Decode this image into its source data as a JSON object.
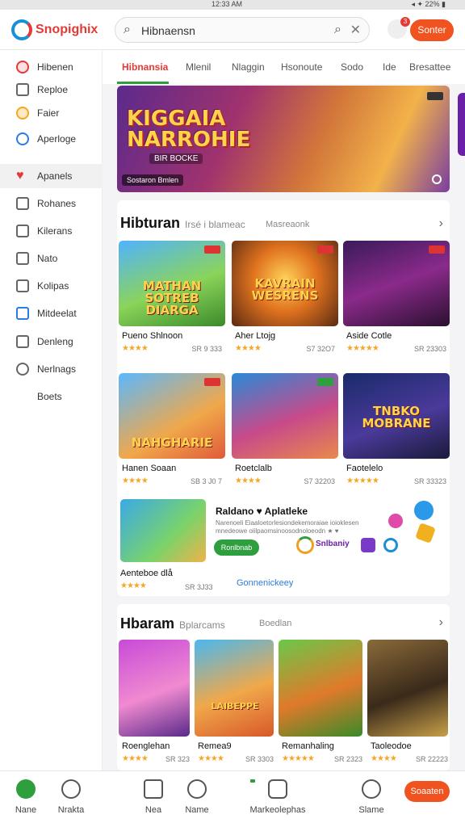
{
  "status_bar": {
    "time": "12:33 AM",
    "right": "◂ ✦ 22% ▮"
  },
  "header": {
    "logo_text": "Snopighix",
    "search_value": "Hibnaensn",
    "notif_count": "3",
    "button_label": "Sonter"
  },
  "sidebar": {
    "items": [
      {
        "label": "Hibenen",
        "icon": "dice-icon"
      },
      {
        "label": "Reploe",
        "icon": "image-icon"
      },
      {
        "label": "Faier",
        "icon": "star-icon"
      },
      {
        "label": "Aperloge",
        "icon": "globe-icon"
      },
      {
        "label": "Apanels",
        "icon": "heart-icon"
      },
      {
        "label": "Rohanes",
        "icon": "grid-icon"
      },
      {
        "label": "Kilerans",
        "icon": "grid-icon"
      },
      {
        "label": "Nato",
        "icon": "edit-icon"
      },
      {
        "label": "Kolipas",
        "icon": "box-icon"
      },
      {
        "label": "Mitdeelat",
        "icon": "list-icon"
      },
      {
        "label": "Denleng",
        "icon": "check-icon"
      },
      {
        "label": "Nerlnags",
        "icon": "settings-icon"
      },
      {
        "label": "Boets",
        "icon": ""
      }
    ]
  },
  "tabs": [
    "Hibnansia",
    "Mlenil",
    "Nlaggin",
    "Hsonoute",
    "Sodo",
    "Ide",
    "Bresattee"
  ],
  "banner": {
    "title": "KIGGAIA NARROHIE",
    "sub": "BIR BOCKE",
    "button": "Sostaron Bmlen"
  },
  "section1": {
    "title": "Hibturan",
    "sub": "Irsé i blameac",
    "sub2": "Masreaonk",
    "cards": [
      {
        "art": "MATHAN SOTREB DIARGA",
        "name": "Pueno Shlnoon",
        "stars": "★★★★",
        "price": "SR 9 333"
      },
      {
        "art": "KAVRAIN WESRENS",
        "name": "Aher Ltojg",
        "stars": "★★★★",
        "price": "S7 32O7"
      },
      {
        "art": "",
        "name": "Aside Cotle",
        "stars": "★★★★★",
        "price": "SR 23303"
      },
      {
        "art": "NAHGHARIE",
        "name": "Hanen Soaan",
        "stars": "★★★★",
        "price": "SB 3 J0 7"
      },
      {
        "art": "",
        "name": "Roetclalb",
        "stars": "★★★★",
        "price": "S7 32203"
      },
      {
        "art": "TNBKO MOBRANE",
        "name": "Faotelelo",
        "stars": "★★★★★",
        "price": "SR 33323"
      }
    ],
    "promo": {
      "title": "Raldano ♥ Aplatleke",
      "desc": "Narenoeli Eiaaloetorlesiondekemoraiae ioioklesen mnedeowe oiilpaomsinoosodnoloeodn ★ ♥",
      "button": "Ronlbnab",
      "brand": "Snlbaniy",
      "name": "Aenteboe dlå",
      "stars": "★★★★",
      "price": "SR 3J33",
      "link": "Gonnenickeey"
    }
  },
  "section2": {
    "title": "Hbaram",
    "sub": "Bplarcams",
    "sub2": "Boedlan",
    "cards": [
      {
        "art": "",
        "name": "Roenglehan",
        "stars": "★★★★",
        "price": "SR 323"
      },
      {
        "art": "LAIBEPPE",
        "name": "Remea9",
        "stars": "★★★★",
        "price": "SR 3303"
      },
      {
        "art": "",
        "name": "Remanhaling",
        "stars": "★★★★★",
        "price": "SR 2323"
      },
      {
        "art": "",
        "name": "Taoleodoe",
        "stars": "★★★★",
        "price": "SR 22223"
      }
    ]
  },
  "tabbar": {
    "items": [
      {
        "label": "Nane",
        "icon": "home-icon"
      },
      {
        "label": "Nrakta",
        "icon": "clock-icon"
      },
      {
        "label": "Nea",
        "icon": "store-icon"
      },
      {
        "label": "Name",
        "icon": "search-icon"
      },
      {
        "label": "Markeolephas",
        "icon": "controller-icon"
      },
      {
        "label": "Slame",
        "icon": "user-icon"
      }
    ],
    "button_label": "Soaaten"
  },
  "colors": {
    "accent": "#f0531f",
    "green": "#2e9e3e",
    "red": "#e53935"
  }
}
